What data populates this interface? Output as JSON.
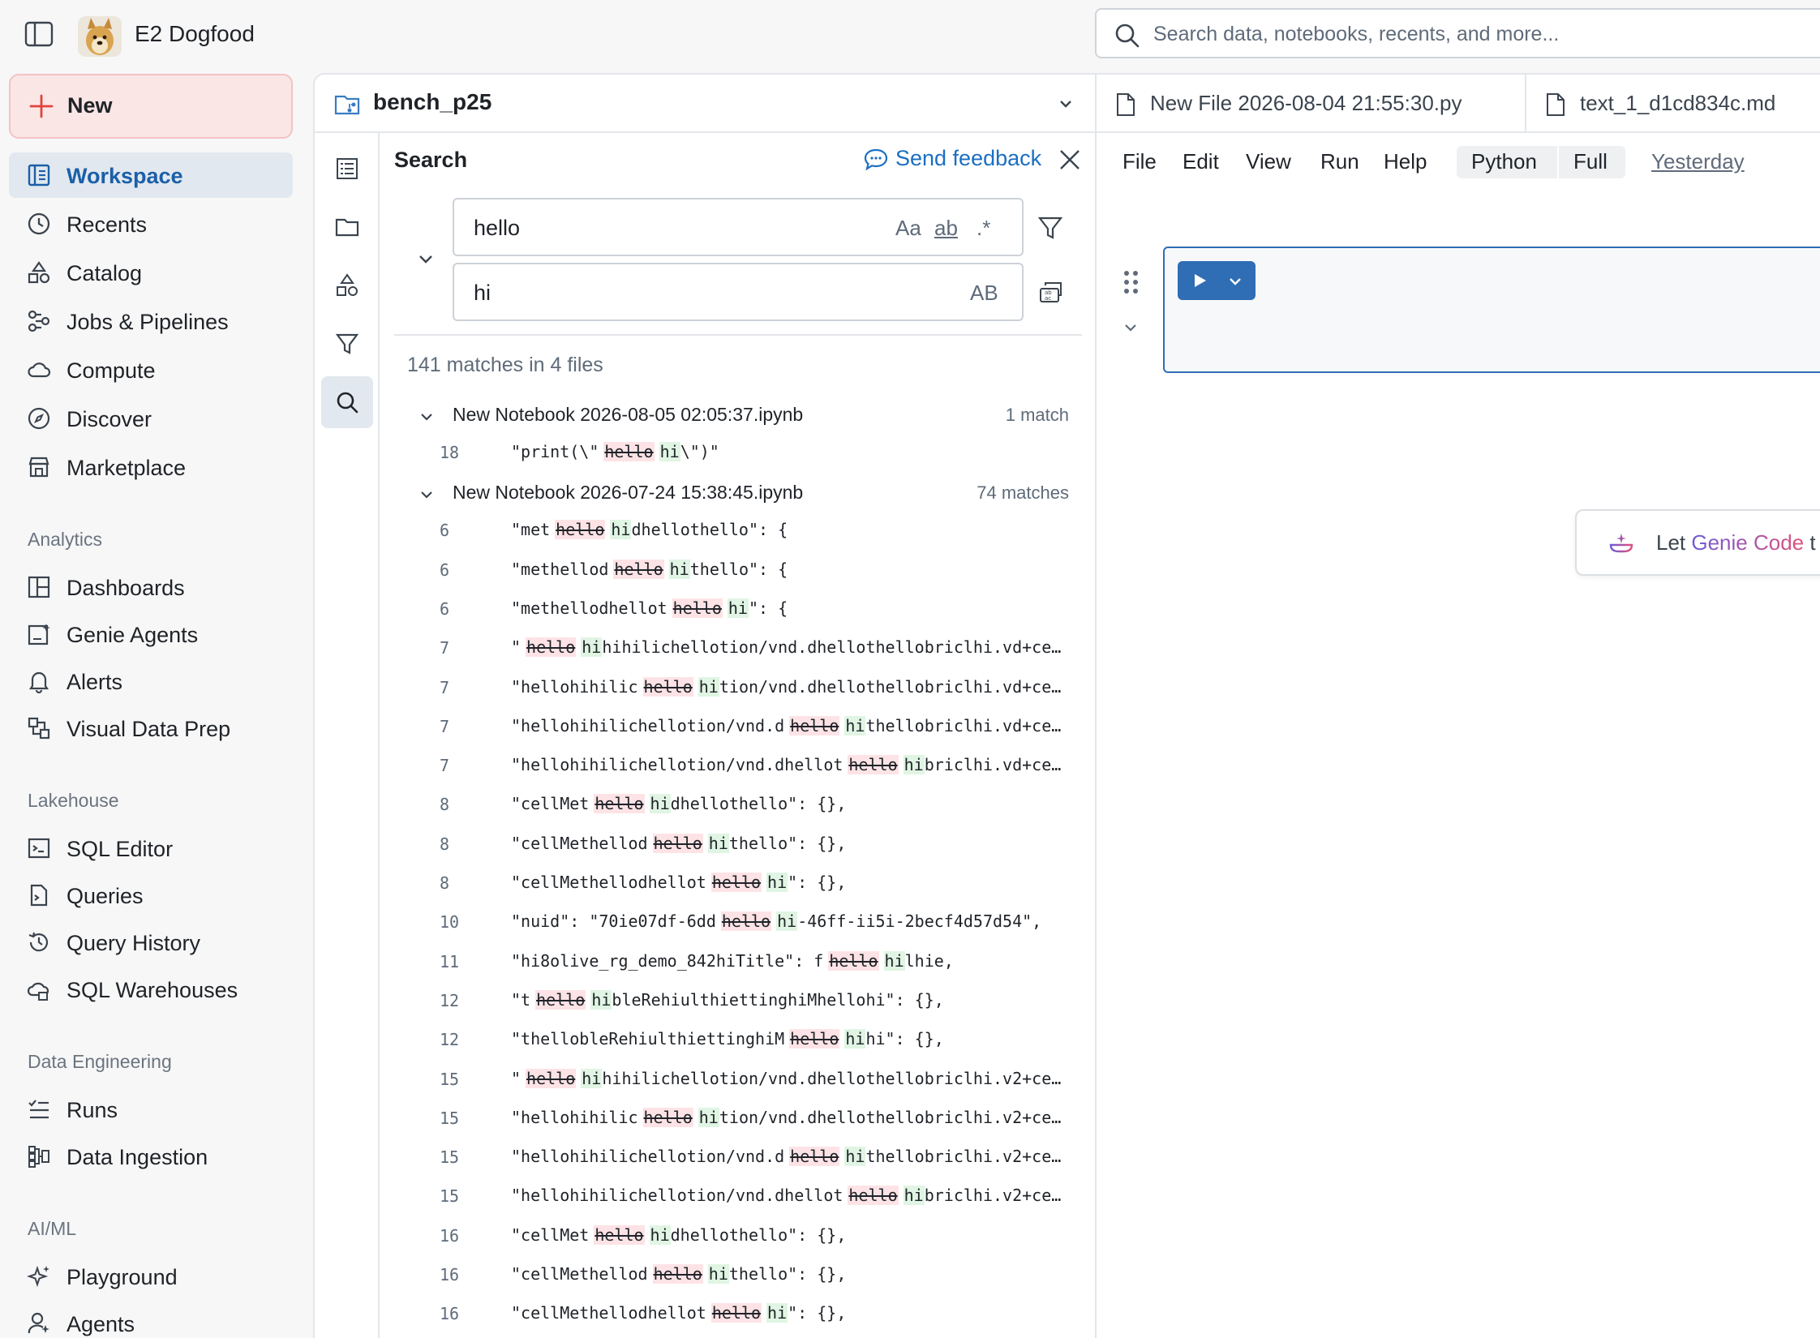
{
  "topbar": {
    "workspace_name": "E2 Dogfood",
    "search_placeholder": "Search data, notebooks, recents, and more..."
  },
  "nav": {
    "new_label": "New",
    "primary": [
      {
        "label": "Workspace",
        "icon": "workspace-icon",
        "active": true
      },
      {
        "label": "Recents",
        "icon": "clock-icon"
      },
      {
        "label": "Catalog",
        "icon": "catalog-icon"
      },
      {
        "label": "Jobs & Pipelines",
        "icon": "jobs-icon"
      },
      {
        "label": "Compute",
        "icon": "cloud-icon"
      },
      {
        "label": "Discover",
        "icon": "compass-icon"
      },
      {
        "label": "Marketplace",
        "icon": "store-icon"
      }
    ],
    "sections": [
      {
        "title": "Analytics",
        "items": [
          {
            "label": "Dashboards",
            "icon": "dashboard-icon"
          },
          {
            "label": "Genie Agents",
            "icon": "genie-icon"
          },
          {
            "label": "Alerts",
            "icon": "bell-icon"
          },
          {
            "label": "Visual Data Prep",
            "icon": "data-prep-icon"
          }
        ]
      },
      {
        "title": "Lakehouse",
        "items": [
          {
            "label": "SQL Editor",
            "icon": "sql-editor-icon"
          },
          {
            "label": "Queries",
            "icon": "query-icon"
          },
          {
            "label": "Query History",
            "icon": "history-icon"
          },
          {
            "label": "SQL Warehouses",
            "icon": "warehouse-icon"
          }
        ]
      },
      {
        "title": "Data Engineering",
        "items": [
          {
            "label": "Runs",
            "icon": "runs-icon"
          },
          {
            "label": "Data Ingestion",
            "icon": "ingestion-icon"
          }
        ]
      },
      {
        "title": "AI/ML",
        "items": [
          {
            "label": "Playground",
            "icon": "sparkle-icon"
          },
          {
            "label": "Agents",
            "icon": "agent-icon"
          }
        ]
      }
    ]
  },
  "explorer": {
    "repo_name": "bench_p25"
  },
  "search": {
    "title": "Search",
    "feedback_label": "Send feedback",
    "find_value": "hello",
    "replace_value": "hi",
    "find_options": [
      "Aa",
      "ab",
      ".*"
    ],
    "replace_option": "AB",
    "summary": "141 matches in 4 files",
    "files": [
      {
        "name": "New Notebook 2026-08-05 02:05:37.ipynb",
        "count": "1 match",
        "matches": [
          {
            "line": "18",
            "pre": "\"print(\\\"",
            "find": "hello",
            "repl": "hi",
            "post": "\\\")\""
          }
        ]
      },
      {
        "name": "New Notebook 2026-07-24 15:38:45.ipynb",
        "count": "74 matches",
        "matches": [
          {
            "line": "6",
            "pre": "\"met",
            "find": "hello",
            "repl": "hi",
            "post": "dhellothello\": {"
          },
          {
            "line": "6",
            "pre": "\"methellod",
            "find": "hello",
            "repl": "hi",
            "post": "thello\": {"
          },
          {
            "line": "6",
            "pre": "\"methellodhellot",
            "find": "hello",
            "repl": "hi",
            "post": "\": {"
          },
          {
            "line": "7",
            "pre": "\"",
            "find": "hello",
            "repl": "hi",
            "post": "hihilichellotion/vnd.dhellothellobriclhi.vd+ce…"
          },
          {
            "line": "7",
            "pre": "\"hellohihilic",
            "find": "hello",
            "repl": "hi",
            "post": "tion/vnd.dhellothellobriclhi.vd+ce…"
          },
          {
            "line": "7",
            "pre": "\"hellohihilichellotion/vnd.d",
            "find": "hello",
            "repl": "hi",
            "post": "thellobriclhi.vd+ce…"
          },
          {
            "line": "7",
            "pre": "\"hellohihilichellotion/vnd.dhellot",
            "find": "hello",
            "repl": "hi",
            "post": "briclhi.vd+ce…"
          },
          {
            "line": "8",
            "pre": "\"cellMet",
            "find": "hello",
            "repl": "hi",
            "post": "dhellothello\": {},"
          },
          {
            "line": "8",
            "pre": "\"cellMethellod",
            "find": "hello",
            "repl": "hi",
            "post": "thello\": {},"
          },
          {
            "line": "8",
            "pre": "\"cellMethellodhellot",
            "find": "hello",
            "repl": "hi",
            "post": "\": {},"
          },
          {
            "line": "10",
            "pre": "\"nuid\": \"70ie07df-6dd",
            "find": "hello",
            "repl": "hi",
            "post": "-46ff-ii5i-2becf4d57d54\","
          },
          {
            "line": "11",
            "pre": "\"hi8olive_rg_demo_842hiTitle\": f",
            "find": "hello",
            "repl": "hi",
            "post": "lhie,"
          },
          {
            "line": "12",
            "pre": "\"t",
            "find": "hello",
            "repl": "hi",
            "post": "bleRehiulthiettinghiMhellohi\": {},"
          },
          {
            "line": "12",
            "pre": "\"thellobleRehiulthiettinghiM",
            "find": "hello",
            "repl": "hi",
            "post": "hi\": {},"
          },
          {
            "line": "15",
            "pre": "\"",
            "find": "hello",
            "repl": "hi",
            "post": "hihilichellotion/vnd.dhellothellobriclhi.v2+ce…"
          },
          {
            "line": "15",
            "pre": "\"hellohihilic",
            "find": "hello",
            "repl": "hi",
            "post": "tion/vnd.dhellothellobriclhi.v2+ce…"
          },
          {
            "line": "15",
            "pre": "\"hellohihilichellotion/vnd.d",
            "find": "hello",
            "repl": "hi",
            "post": "thellobriclhi.v2+ce…"
          },
          {
            "line": "15",
            "pre": "\"hellohihilichellotion/vnd.dhellot",
            "find": "hello",
            "repl": "hi",
            "post": "briclhi.v2+ce…"
          },
          {
            "line": "16",
            "pre": "\"cellMet",
            "find": "hello",
            "repl": "hi",
            "post": "dhellothello\": {},"
          },
          {
            "line": "16",
            "pre": "\"cellMethellod",
            "find": "hello",
            "repl": "hi",
            "post": "thello\": {},"
          },
          {
            "line": "16",
            "pre": "\"cellMethellodhellot",
            "find": "hello",
            "repl": "hi",
            "post": "\": {},"
          }
        ]
      }
    ]
  },
  "editor": {
    "tabs": [
      {
        "label": "New File 2026-08-04 21:55:30.py"
      },
      {
        "label": "text_1_d1cd834c.md"
      }
    ],
    "menu": [
      "File",
      "Edit",
      "View",
      "Run",
      "Help"
    ],
    "language": "Python",
    "mode": "Full",
    "last_saved": "Yesterday",
    "genie_prefix": "Let ",
    "genie_name": "Genie Code",
    "genie_suffix": " t"
  },
  "colors": {
    "accent": "#2f6db5",
    "new_button_bg": "#fbe6e6",
    "active_nav_bg": "#e2e8ef",
    "find_highlight": "#fde3e6",
    "replace_highlight": "#e0f5e3",
    "link": "#1b6fc2"
  }
}
